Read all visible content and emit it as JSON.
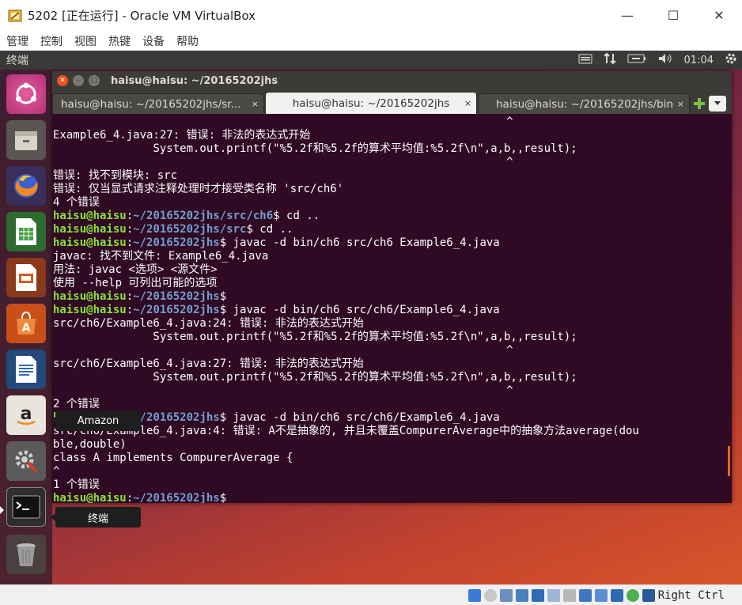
{
  "window": {
    "title": "5202 [正在运行] - Oracle VM VirtualBox",
    "minimize": "—",
    "maximize": "☐",
    "close": "✕"
  },
  "menubar": [
    "管理",
    "控制",
    "视图",
    "热键",
    "设备",
    "帮助"
  ],
  "panel": {
    "app_name": "终端",
    "time": "01:04"
  },
  "launcher": {
    "items": [
      "ubuntu-dash",
      "files",
      "firefox",
      "libreoffice-calc",
      "libreoffice-impress",
      "ubuntu-software",
      "libreoffice-writer",
      "amazon",
      "system-settings",
      "terminal",
      "trash"
    ],
    "tooltip_amazon": "Amazon",
    "tooltip_terminal": "终端"
  },
  "terminal": {
    "title": "haisu@haisu: ~/20165202jhs",
    "tabs": [
      "haisu@haisu: ~/20165202jhs/sr...",
      "haisu@haisu: ~/20165202jhs",
      "haisu@haisu: ~/20165202jhs/bin"
    ],
    "tab_close": "×",
    "lines": [
      {
        "t": "                                                                    ^"
      },
      {
        "t": "Example6_4.java:27: 错误: 非法的表达式开始"
      },
      {
        "t": "               System.out.printf(\"%5.2f和%5.2f的算术平均值:%5.2f\\n\",a,b,,result);"
      },
      {
        "t": "                                                                    ^"
      },
      {
        "t": "错误: 找不到模块: src"
      },
      {
        "t": "错误: 仅当显式请求注释处理时才接受类名称 'src/ch6'"
      },
      {
        "t": "4 个错误"
      },
      {
        "u": "haisu@haisu",
        "p": "~/20165202jhs/src/ch6",
        "c": "$ cd .."
      },
      {
        "u": "haisu@haisu",
        "p": "~/20165202jhs/src",
        "c": "$ cd .."
      },
      {
        "u": "haisu@haisu",
        "p": "~/20165202jhs",
        "c": "$ javac -d bin/ch6 src/ch6 Example6_4.java"
      },
      {
        "t": "javac: 找不到文件: Example6_4.java"
      },
      {
        "t": "用法: javac <选项> <源文件>"
      },
      {
        "t": "使用 --help 可列出可能的选项"
      },
      {
        "u": "haisu@haisu",
        "p": "~/20165202jhs",
        "c": "$"
      },
      {
        "u": "haisu@haisu",
        "p": "~/20165202jhs",
        "c": "$ javac -d bin/ch6 src/ch6/Example6_4.java"
      },
      {
        "t": "src/ch6/Example6_4.java:24: 错误: 非法的表达式开始"
      },
      {
        "t": "               System.out.printf(\"%5.2f和%5.2f的算术平均值:%5.2f\\n\",a,b,,result);"
      },
      {
        "t": "                                                                    ^"
      },
      {
        "t": "src/ch6/Example6_4.java:27: 错误: 非法的表达式开始"
      },
      {
        "t": "               System.out.printf(\"%5.2f和%5.2f的算术平均值:%5.2f\\n\",a,b,,result);"
      },
      {
        "t": "                                                                    ^"
      },
      {
        "t": "2 个错误"
      },
      {
        "u": "haisu@haisu",
        "p": "~/20165202jhs",
        "c": "$ javac -d bin/ch6 src/ch6/Example6_4.java"
      },
      {
        "t": "src/ch6/Example6_4.java:4: 错误: A不是抽象的, 并且未覆盖CompurerAverage中的抽象方法average(dou"
      },
      {
        "t": "ble,double)"
      },
      {
        "t": "class A implements CompurerAverage {"
      },
      {
        "t": "^"
      },
      {
        "t": "1 个错误"
      },
      {
        "u": "haisu@haisu",
        "p": "~/20165202jhs",
        "c": "$ "
      }
    ]
  },
  "statusbar": {
    "host_key": "Right Ctrl"
  },
  "colors": {
    "terminal_bg": "#300a24",
    "prompt_user": "#8ae234",
    "prompt_path": "#729fcf"
  }
}
